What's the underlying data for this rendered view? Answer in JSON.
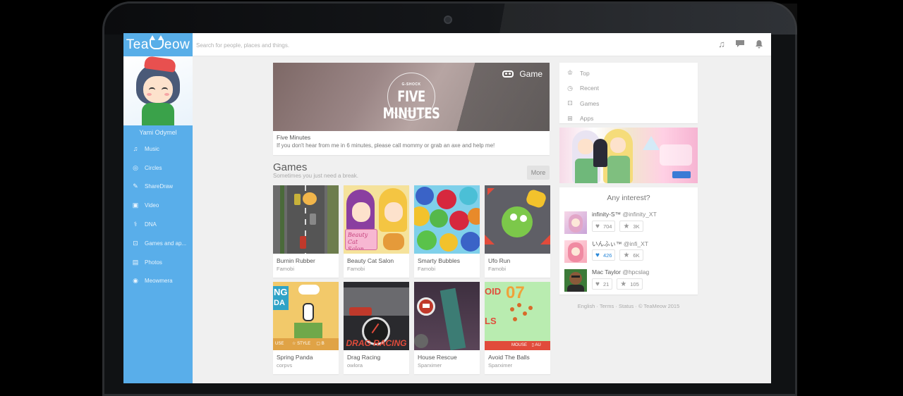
{
  "app": {
    "logo_text_1": "Tea",
    "logo_text_2": "eow"
  },
  "search": {
    "placeholder": "Search for people, places and things."
  },
  "sidebar": {
    "username": "Yami Odymel",
    "items": [
      {
        "label": "Music",
        "icon": "music-note-icon"
      },
      {
        "label": "Circles",
        "icon": "circles-icon"
      },
      {
        "label": "ShareDraw",
        "icon": "pen-icon"
      },
      {
        "label": "Video",
        "icon": "video-icon"
      },
      {
        "label": "DNA",
        "icon": "dna-icon"
      },
      {
        "label": "Games and ap...",
        "icon": "gamepad-icon"
      },
      {
        "label": "Photos",
        "icon": "photo-icon"
      },
      {
        "label": "Meowmera",
        "icon": "camera-icon"
      }
    ]
  },
  "hero": {
    "brand": "G-SHOCK",
    "title": "FIVE MINUTES",
    "category": "Game",
    "name": "Five Minutes",
    "description": "If you don't hear from me in 6 minutes, please call mommy or grab an axe and help me!"
  },
  "games_section": {
    "title": "Games",
    "subtitle": "Sometimes you just need a break.",
    "more_label": "More",
    "items": [
      {
        "name": "Burnin Rubber",
        "author": "Famobi"
      },
      {
        "name": "Beauty Cat Salon",
        "author": "Famobi"
      },
      {
        "name": "Smarty Bubbles",
        "author": "Famobi"
      },
      {
        "name": "Ufo Run",
        "author": "Famobi"
      },
      {
        "name": "Spring Panda",
        "author": "corpvs"
      },
      {
        "name": "Drag Racing",
        "author": "owlora"
      },
      {
        "name": "House Rescue",
        "author": "Sparximer"
      },
      {
        "name": "Avoid The Balls",
        "author": "Sparximer"
      }
    ],
    "thumb_texts": {
      "beauty": "Beauty Cat Salon",
      "panda_top": "NG",
      "panda_mid": "DA",
      "panda_bar_left": "USE",
      "panda_bar_mid": "STYLE",
      "panda_bar_right": "B",
      "drag": "DRAG RACING",
      "avoid_num": "07",
      "avoid_1": "OID",
      "avoid_2": "LS",
      "avoid_bar": "MOUSE",
      "avoid_bar2": "AU"
    }
  },
  "right_menu": {
    "items": [
      {
        "label": "Top",
        "icon": "trophy-icon"
      },
      {
        "label": "Recent",
        "icon": "clock-icon"
      },
      {
        "label": "Games",
        "icon": "gamepad-icon"
      },
      {
        "label": "Apps",
        "icon": "apps-icon"
      }
    ]
  },
  "interest": {
    "title": "Any interest?",
    "people": [
      {
        "name": "infinity-S™",
        "handle": "@infinity_XT",
        "likes": "704",
        "stars": "3K",
        "liked": false
      },
      {
        "name": "いんふぃ™",
        "handle": "@infi_XT",
        "likes": "426",
        "stars": "6K",
        "liked": true
      },
      {
        "name": "Mac Taylor",
        "handle": "@hpcslag",
        "likes": "21",
        "stars": "105",
        "liked": false
      }
    ]
  },
  "footer": {
    "english": "English",
    "terms": "Terms",
    "status": "Status",
    "copyright": "© TeaMeow 2015",
    "sep": "·"
  },
  "colors": {
    "accent": "#59aeea",
    "liked": "#2b88d8"
  }
}
